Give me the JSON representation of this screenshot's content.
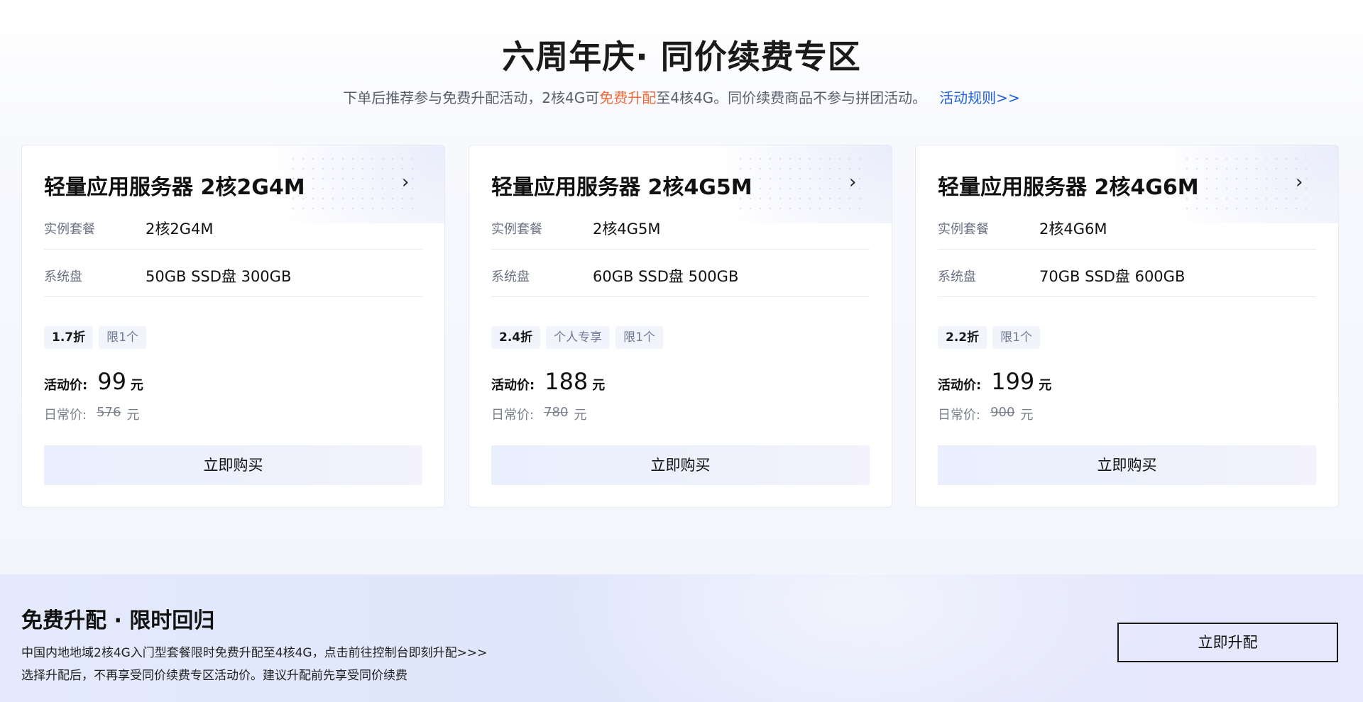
{
  "page": {
    "title": "六周年庆· 同价续费专区",
    "subtitle_before": "下单后推荐参与免费升配活动，2核4G可",
    "subtitle_highlight": "免费升配",
    "subtitle_after": "至4核4G。同价续费商品不参与拼团活动。",
    "rules_link": "活动规则>>",
    "highlight_color": "#ee6b3a",
    "link_color": "#1f5fd6"
  },
  "cards": [
    {
      "title": "轻量应用服务器 2核2G4M",
      "instance_label": "实例套餐",
      "instance_value": "2核2G4M",
      "disk_label": "系统盘",
      "disk_value": "50GB SSD盘 300GB",
      "tags": [
        "1.7折",
        "限1个"
      ],
      "price_label": "活动价:",
      "price": "99",
      "price_unit": "元",
      "orig_label": "日常价:",
      "orig_price": "576",
      "orig_unit": "元",
      "buy_label": "立即购买"
    },
    {
      "title": "轻量应用服务器 2核4G5M",
      "instance_label": "实例套餐",
      "instance_value": "2核4G5M",
      "disk_label": "系统盘",
      "disk_value": "60GB SSD盘 500GB",
      "tags": [
        "2.4折",
        "个人专享",
        "限1个"
      ],
      "price_label": "活动价:",
      "price": "188",
      "price_unit": "元",
      "orig_label": "日常价:",
      "orig_price": "780",
      "orig_unit": "元",
      "buy_label": "立即购买"
    },
    {
      "title": "轻量应用服务器 2核4G6M",
      "instance_label": "实例套餐",
      "instance_value": "2核4G6M",
      "disk_label": "系统盘",
      "disk_value": "70GB SSD盘 600GB",
      "tags": [
        "2.2折",
        "限1个"
      ],
      "price_label": "活动价:",
      "price": "199",
      "price_unit": "元",
      "orig_label": "日常价:",
      "orig_price": "900",
      "orig_unit": "元",
      "buy_label": "立即购买"
    }
  ],
  "promo": {
    "title": "免费升配 · 限时回归",
    "line1": "中国内地地域2核4G入门型套餐限时免费升配至4核4G，点击前往控制台即刻升配>>>",
    "line2": "选择升配后，不再享受同价续费专区活动价。建议升配前先享受同价续费",
    "button": "立即升配"
  },
  "icons": {
    "card_arrow": "chevron-right-icon"
  }
}
